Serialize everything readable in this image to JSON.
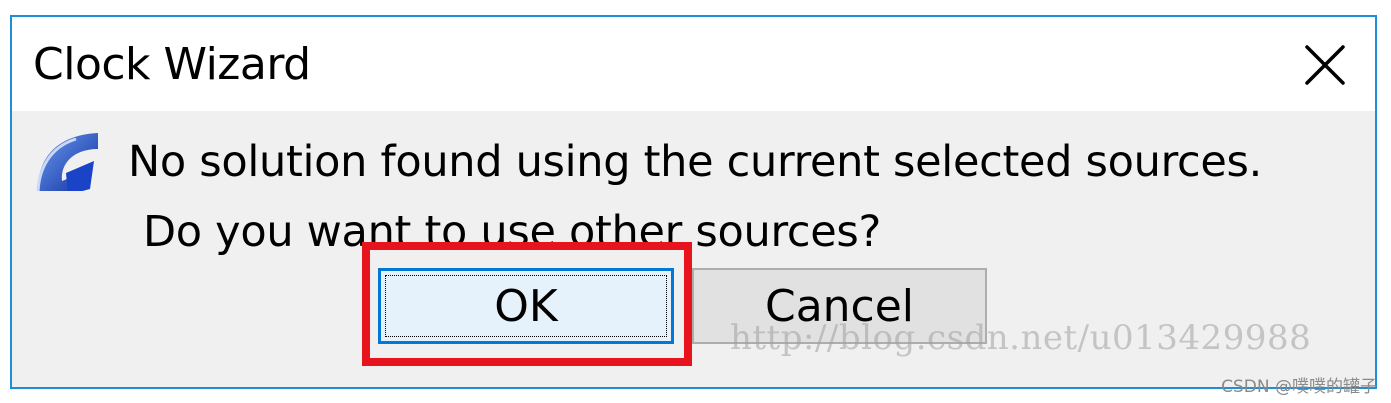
{
  "window": {
    "title": "Clock Wizard"
  },
  "message": {
    "line1": "No solution found using the current selected sources.",
    "line2": "Do you want to use other sources?"
  },
  "buttons": {
    "ok_label": "OK",
    "cancel_label": "Cancel"
  },
  "overlay": {
    "watermark": "http://blog.csdn.net/u013429988",
    "credit": "CSDN @噗噗的罐子"
  },
  "colors": {
    "window_border": "#1c8fd6",
    "highlight": "#e8141d",
    "ok_focus": "#0078d7"
  },
  "icons": {
    "close": "close-icon",
    "app": "vivado-logo-icon"
  }
}
